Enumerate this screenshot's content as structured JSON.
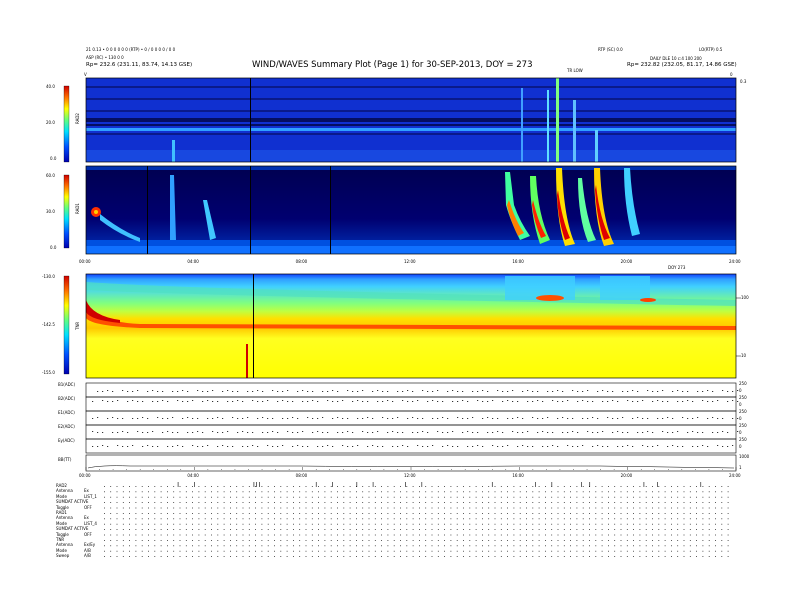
{
  "header": {
    "left_line1": "21 0.13 • 0 0 0 0 0 0 (RTP) • 0 / 0 0 0 0 / 0 0",
    "left_line2": "ASP (RC) • 130 0 0",
    "left_rp": "Rp= 232.6 (231.11, 83.74, 14.13 GSE)",
    "title": "WIND/WAVES Summary Plot (Page 1) for 30-SEP-2013, DOY = 273",
    "right_top1": "RTP (SC) 0.0",
    "right_top2": "LO(RTP) 0.5",
    "right_line2": "DAILY DLE 10 c:4  100 200",
    "right_rp": "Rp= 232.82 (232.05, 81.17, 14.86 GSE)",
    "tr_label": "TR LOW"
  },
  "rad2": {
    "ylabel": "RAD2",
    "colorbar_ticks": [
      "40.0",
      "20.0",
      "0.0"
    ],
    "corner_left": "V",
    "corner_right": "0",
    "corner_far": "0.3"
  },
  "rad1": {
    "ylabel": "RAD1",
    "colorbar_ticks": [
      "60.0",
      "30.0",
      "0.0"
    ],
    "xticks": [
      "00:00",
      "04:00",
      "08:00",
      "12:00",
      "16:00",
      "20:00",
      "24:00"
    ],
    "x_right_label": "DOY 273"
  },
  "tnr": {
    "ylabel": "TNR",
    "colorbar_ticks": [
      "-130.0",
      "-142.5",
      "-155.0"
    ],
    "right_ticks": [
      "100",
      "10"
    ]
  },
  "channels": {
    "labels": [
      "B1(ADC)",
      "B2(ADC)",
      "E1(ADC)",
      "E2(ADC)",
      "Ey(ADC)",
      "BB(TT)"
    ],
    "right_ticks": [
      "250",
      "0",
      "250",
      "0",
      "250",
      "0",
      "250",
      "0",
      "250",
      "0",
      "1000",
      "1"
    ],
    "xticks": [
      "00:00",
      "04:00",
      "08:00",
      "12:00",
      "16:00",
      "20:00",
      "24:00"
    ]
  },
  "modes": {
    "rows": [
      {
        "label": "RAD2",
        "value": ""
      },
      {
        "label": "Antenna",
        "value": "Ex"
      },
      {
        "label": "Mode",
        "value": "LIST_1"
      },
      {
        "label": "SUMDAT ACTIVE",
        "value": ""
      },
      {
        "label": "Toggle",
        "value": "OFF"
      },
      {
        "label": "RAD1",
        "value": ""
      },
      {
        "label": "Antenna",
        "value": "Ex"
      },
      {
        "label": "Mode",
        "value": "LIST_4"
      },
      {
        "label": "SUMDAT ACTIVE",
        "value": ""
      },
      {
        "label": "Toggle",
        "value": "OFF"
      },
      {
        "label": "TNR",
        "value": ""
      },
      {
        "label": "Antenna",
        "value": "Ex/Ey"
      },
      {
        "label": "Mode",
        "value": "A/B"
      },
      {
        "label": "Sweep",
        "value": "A/B"
      }
    ]
  },
  "chart_data": [
    {
      "type": "heatmap",
      "title": "WIND/WAVES Summary Plot (Page 1) for 30-SEP-2013, DOY = 273",
      "ylabel": "RAD2",
      "x_range_hours": [
        0,
        24
      ],
      "colorbar_range": [
        0.0,
        40.0
      ],
      "bursts_hours": [
        17.55,
        17.8,
        18.7,
        19.3
      ]
    },
    {
      "type": "heatmap",
      "ylabel": "RAD1",
      "x_range_hours": [
        0,
        24
      ],
      "xticks": [
        "00:00",
        "04:00",
        "08:00",
        "12:00",
        "16:00",
        "20:00",
        "24:00"
      ],
      "colorbar_range": [
        0.0,
        60.0
      ],
      "bursts_hours": [
        0.3,
        3.3,
        4.4,
        15.8,
        16.4,
        17.2,
        17.9,
        18.7,
        19.6,
        20.1
      ]
    },
    {
      "type": "heatmap",
      "ylabel": "TNR",
      "x_range_hours": [
        0,
        24
      ],
      "colorbar_range": [
        -155.0,
        -130.0
      ],
      "right_axis_ticks": [
        100,
        10
      ]
    }
  ]
}
